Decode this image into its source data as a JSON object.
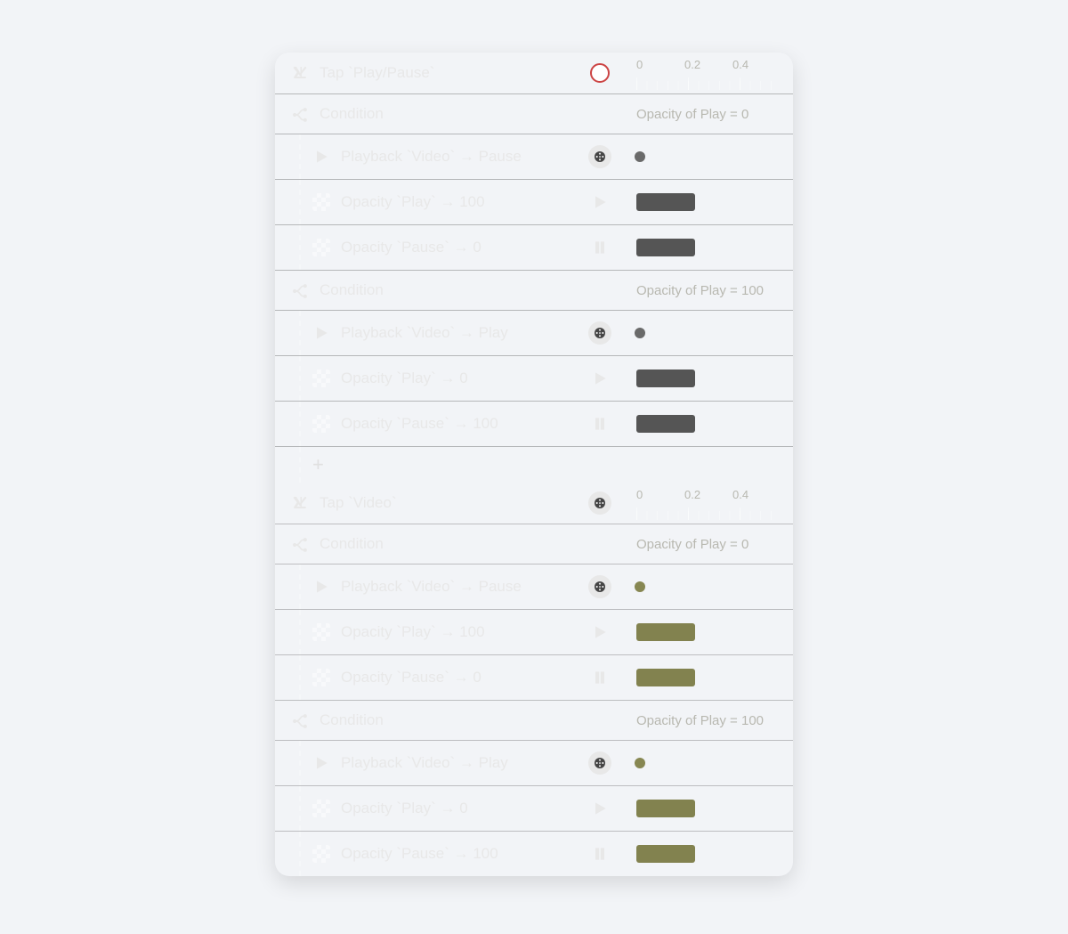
{
  "timeline_ticks": [
    "0",
    "0.2",
    "0.4"
  ],
  "sections": [
    {
      "theme": "dark",
      "trigger": {
        "label": "Tap `Play/Pause`",
        "badge": "ring"
      },
      "groups": [
        {
          "condition_label": "Condition",
          "right_text": "Opacity of Play = 0",
          "rows": [
            {
              "icon": "play",
              "label": "Playback `Video` → Pause",
              "tail": "film",
              "tl": "dot"
            },
            {
              "icon": "opacity",
              "label": "Opacity `Play` → 100",
              "tail": "play",
              "tl": "bar"
            },
            {
              "icon": "opacity",
              "label": "Opacity `Pause` → 0",
              "tail": "pause",
              "tl": "bar"
            }
          ]
        },
        {
          "condition_label": "Condition",
          "right_text": "Opacity of Play = 100",
          "rows": [
            {
              "icon": "play",
              "label": "Playback `Video` → Play",
              "tail": "film",
              "tl": "dot"
            },
            {
              "icon": "opacity",
              "label": "Opacity `Play` → 0",
              "tail": "play",
              "tl": "bar"
            },
            {
              "icon": "opacity",
              "label": "Opacity `Pause` → 100",
              "tail": "pause",
              "tl": "bar"
            }
          ]
        }
      ],
      "show_plus": true
    },
    {
      "theme": "olive",
      "trigger": {
        "label": "Tap `Video`",
        "badge": "film"
      },
      "groups": [
        {
          "condition_label": "Condition",
          "right_text": "Opacity of Play = 0",
          "rows": [
            {
              "icon": "play",
              "label": "Playback `Video` → Pause",
              "tail": "film",
              "tl": "dot"
            },
            {
              "icon": "opacity",
              "label": "Opacity `Play` → 100",
              "tail": "play",
              "tl": "bar"
            },
            {
              "icon": "opacity",
              "label": "Opacity `Pause` → 0",
              "tail": "pause",
              "tl": "bar"
            }
          ]
        },
        {
          "condition_label": "Condition",
          "right_text": "Opacity of Play = 100",
          "rows": [
            {
              "icon": "play",
              "label": "Playback `Video` → Play",
              "tail": "film",
              "tl": "dot"
            },
            {
              "icon": "opacity",
              "label": "Opacity `Play` → 0",
              "tail": "play",
              "tl": "bar"
            },
            {
              "icon": "opacity",
              "label": "Opacity `Pause` → 100",
              "tail": "pause",
              "tl": "bar"
            }
          ]
        }
      ],
      "show_plus": false
    }
  ]
}
